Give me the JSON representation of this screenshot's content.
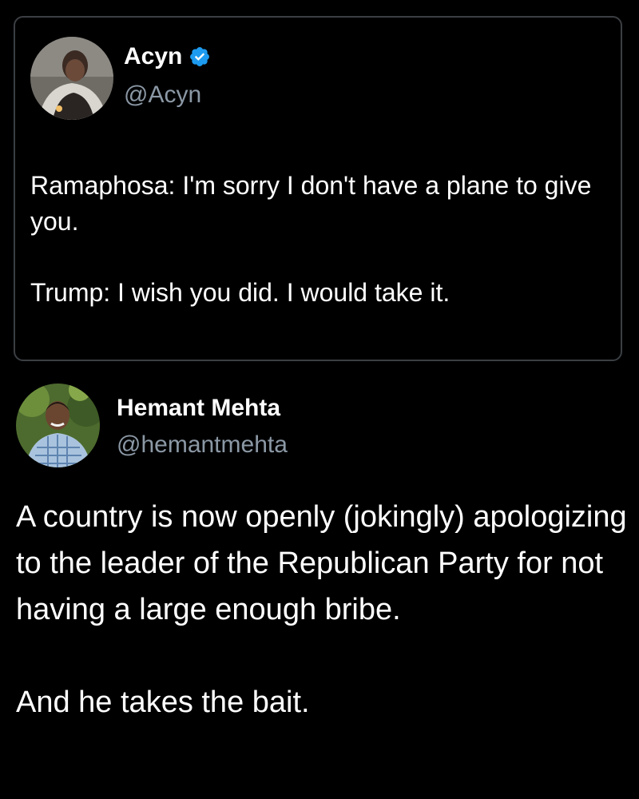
{
  "quoted_tweet": {
    "author": {
      "name": "Acyn",
      "handle": "@Acyn",
      "verified": true,
      "verified_color": "#1d9bf0"
    },
    "paragraphs": [
      "Ramaphosa: I'm sorry I don't have a plane to give you.",
      "Trump: I wish you did. I would take it."
    ]
  },
  "tweet": {
    "author": {
      "name": "Hemant Mehta",
      "handle": "@hemantmehta"
    },
    "paragraphs": [
      "A country is now openly (jokingly) apologizing to the leader of the Republican Party for not having a large enough bribe.",
      "And he takes the bait."
    ]
  }
}
